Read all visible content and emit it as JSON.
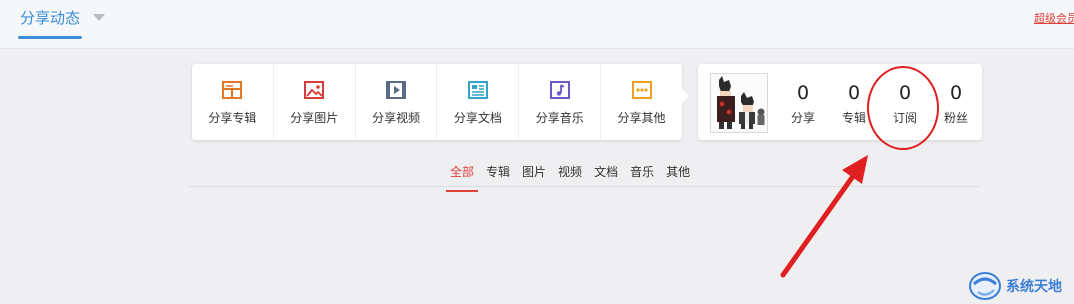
{
  "header": {
    "title": "分享动态",
    "vip_link": "超级会员"
  },
  "share_actions": [
    {
      "label": "分享专辑",
      "icon": "album-icon",
      "color": "#e87722"
    },
    {
      "label": "分享图片",
      "icon": "image-icon",
      "color": "#d93a3a"
    },
    {
      "label": "分享视频",
      "icon": "video-icon",
      "color": "#5a6b88"
    },
    {
      "label": "分享文档",
      "icon": "document-icon",
      "color": "#33a3c9"
    },
    {
      "label": "分享音乐",
      "icon": "music-icon",
      "color": "#6b58c9"
    },
    {
      "label": "分享其他",
      "icon": "more-icon",
      "color": "#f0a020"
    }
  ],
  "profile": {
    "stats": [
      {
        "value": "0",
        "label": "分享"
      },
      {
        "value": "0",
        "label": "专辑"
      },
      {
        "value": "0",
        "label": "订阅"
      },
      {
        "value": "0",
        "label": "粉丝"
      }
    ]
  },
  "filter_tabs": [
    {
      "label": "全部",
      "active": true
    },
    {
      "label": "专辑"
    },
    {
      "label": "图片"
    },
    {
      "label": "视频"
    },
    {
      "label": "文档"
    },
    {
      "label": "音乐"
    },
    {
      "label": "其他"
    }
  ],
  "annotation_color": "#e02020",
  "watermark": {
    "text": "系统天地"
  }
}
